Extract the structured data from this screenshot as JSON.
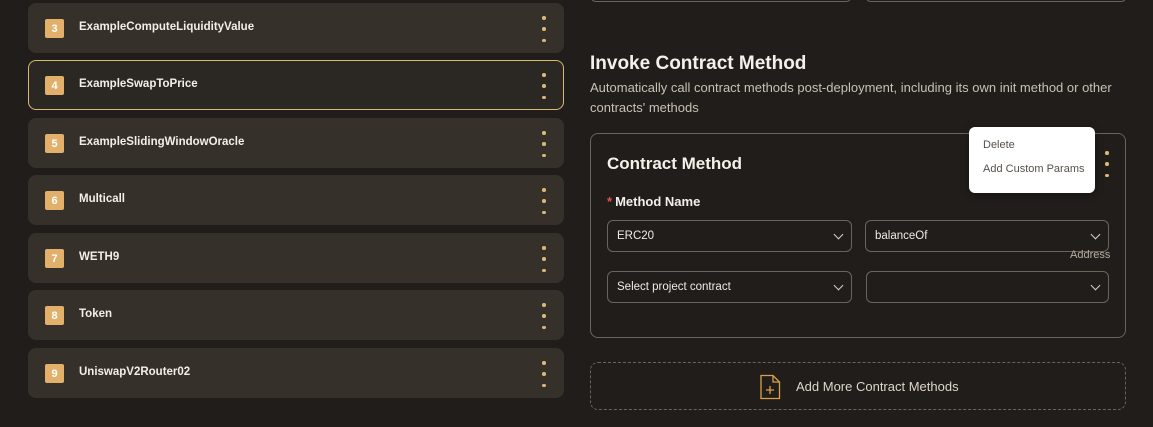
{
  "contracts_list": {
    "items": [
      {
        "index": "3",
        "name": "ExampleComputeLiquidityValue"
      },
      {
        "index": "4",
        "name": "ExampleSwapToPrice"
      },
      {
        "index": "5",
        "name": "ExampleSlidingWindowOracle"
      },
      {
        "index": "6",
        "name": "Multicall"
      },
      {
        "index": "7",
        "name": "WETH9"
      },
      {
        "index": "8",
        "name": "Token"
      },
      {
        "index": "9",
        "name": "UniswapV2Router02"
      }
    ]
  },
  "invoke": {
    "title": "Invoke Contract Method",
    "description": "Automatically call contract methods post-deployment, including its own init method or other contracts' methods"
  },
  "contract_method": {
    "title": "Contract Method",
    "required_mark": "*",
    "method_name_label": "Method Name",
    "contract_select": "ERC20",
    "method_select": "balanceOf",
    "address_label": "Address",
    "project_contract_placeholder": "Select project contract",
    "address_select": ""
  },
  "popup_menu": {
    "delete_label": "Delete",
    "custom_params_label": "Add Custom Params"
  },
  "add_more_label": "Add More Contract Methods",
  "colors": {
    "background": "#201d1a",
    "accent": "#d9b878",
    "badge": "#e2b06b",
    "required": "#e0524a"
  }
}
